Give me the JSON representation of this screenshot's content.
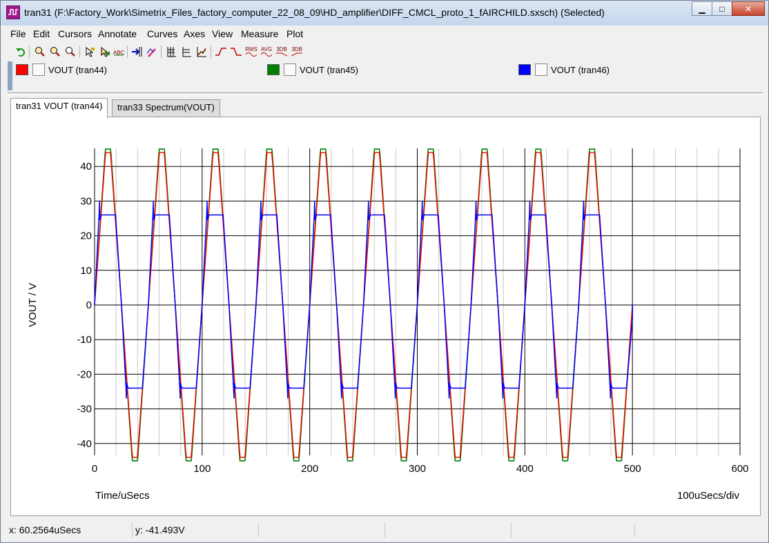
{
  "window": {
    "title": "tran31 (F:\\Factory_Work\\Simetrix_Files_factory_computer_22_08_09\\HD_amplifier\\DIFF_CMCL_proto_1_fAIRCHILD.sxsch) (Selected)",
    "minimize_glyph": "▁",
    "maximize_glyph": "□",
    "close_glyph": "✕"
  },
  "menu": [
    "File",
    "Edit",
    "Cursors",
    "Annotate",
    "Curves",
    "Axes",
    "View",
    "Measure",
    "Plot"
  ],
  "toolbar": {
    "icons": [
      "undo-icon",
      "zoom-in-icon",
      "zoom-rect-icon",
      "zoom-fit-icon",
      "cursor-a-icon",
      "cursor-b-icon",
      "label-abc-icon",
      "add-curve-icon",
      "edit-curve-icon",
      "grid-a-icon",
      "grid-b-icon",
      "graph-icon",
      "rise-icon",
      "fall-icon",
      "rms-icon",
      "avg-icon",
      "3db-high-icon",
      "3db-low-icon"
    ],
    "rms_label": "RMS",
    "avg_label": "AVG",
    "db1_label": "3DB",
    "db2_label": "3DB"
  },
  "legend": [
    {
      "label": "VOUT (tran44)",
      "color": "#ff0000"
    },
    {
      "label": "VOUT (tran45)",
      "color": "#008000"
    },
    {
      "label": "VOUT (tran46)",
      "color": "#0000ff"
    }
  ],
  "tabs": [
    {
      "label": "tran31 VOUT (tran44)",
      "active": true
    },
    {
      "label": "tran33 Spectrum(VOUT)",
      "active": false
    }
  ],
  "chart_data": {
    "type": "line",
    "xlabel": "Time/uSecs",
    "ylabel": "VOUT / V",
    "xscale_label": "100uSecs/div",
    "xlim": [
      0,
      600
    ],
    "ylim": [
      -45,
      45
    ],
    "x_ticks": [
      0,
      100,
      200,
      300,
      400,
      500,
      600
    ],
    "y_ticks": [
      -40,
      -30,
      -20,
      -10,
      0,
      10,
      20,
      30,
      40
    ],
    "grid": true,
    "period_us": 50,
    "cycles": 10,
    "x_end": 500,
    "series": [
      {
        "name": "VOUT (tran44)",
        "color": "#ff0000",
        "high": 44,
        "low": -44
      },
      {
        "name": "VOUT (tran45)",
        "color": "#008000",
        "high": 45,
        "low": -45
      },
      {
        "name": "VOUT (tran46)",
        "color": "#0000ff",
        "high": 26,
        "low": -24
      }
    ]
  },
  "status": {
    "x": "x: 60.2564uSecs",
    "y": "y: -41.493V"
  }
}
